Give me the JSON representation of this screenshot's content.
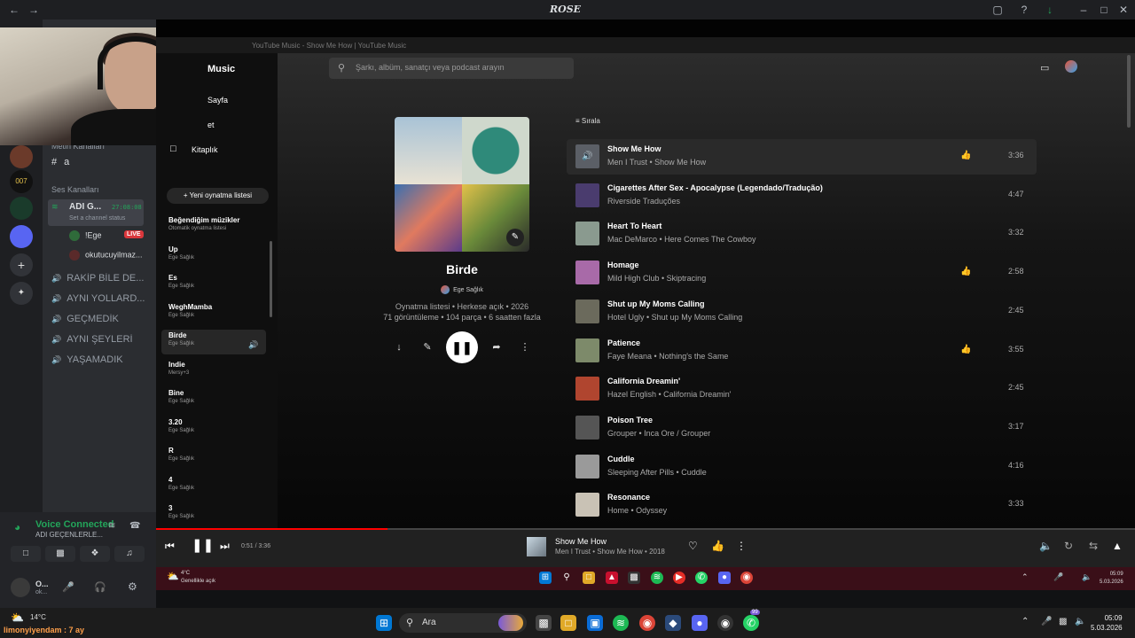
{
  "discord": {
    "title": "ROSE",
    "text_channels_header": "Metin Kanalları",
    "text_channel": "a",
    "voice_channels_header": "Ses Kanalları",
    "active_voice": {
      "name": "ADI G...",
      "timer": "27:08:08",
      "status_placeholder": "Set a channel status"
    },
    "members": [
      {
        "name": "!Ege",
        "badge": "LIVE"
      },
      {
        "name": "okutucuyilmaz..."
      }
    ],
    "voice_channels": [
      "RAKİP BİLE DE...",
      "AYNI YOLLARD...",
      "GEÇMEDİK",
      "AYNI ŞEYLERİ",
      "YAŞAMADIK"
    ],
    "voice_panel": {
      "status": "Voice Connected",
      "channel": "ADI GEÇENLERLE..."
    },
    "user": {
      "name": "O...",
      "sub": "ok..."
    }
  },
  "ytm": {
    "window_title": "YouTube Music - Show Me How | YouTube Music",
    "brand": "Music",
    "nav": [
      {
        "label": "Sayfa",
        "icon": "home-icon"
      },
      {
        "label": "et",
        "icon": "explore-icon"
      },
      {
        "label": "Kitaplık",
        "icon": "library-icon"
      }
    ],
    "new_playlist": "Yeni oynatma listesi",
    "sidebar_playlists": [
      {
        "title": "Beğendiğim müzikler",
        "sub": "Otomatik oynatma listesi"
      },
      {
        "title": "Up",
        "sub": "Ege Sağlık"
      },
      {
        "title": "Es",
        "sub": "Ege Sağlık"
      },
      {
        "title": "WeghMamba",
        "sub": "Ege Sağlık"
      },
      {
        "title": "Birde",
        "sub": "Ege Sağlık"
      },
      {
        "title": "Indie",
        "sub": "Mersy+3"
      },
      {
        "title": "Bine",
        "sub": "Ege Sağlık"
      },
      {
        "title": "3.20",
        "sub": "Ege Sağlık"
      },
      {
        "title": "R",
        "sub": "Ege Sağlık"
      },
      {
        "title": "4",
        "sub": "Ege Sağlık"
      },
      {
        "title": "3",
        "sub": "Ege Sağlık"
      }
    ],
    "search_placeholder": "Şarkı, albüm, sanatçı veya podcast arayın",
    "playlist": {
      "title": "Birde",
      "owner": "Ege Sağlık",
      "meta1": "Oynatma listesi • Herkese açık • 2026",
      "meta2": "71 görüntüleme • 104 parça • 6 saatten fazla"
    },
    "sort_label": "Sırala",
    "tracks": [
      {
        "title": "Show Me How",
        "sub": "Men I Trust • Show Me How",
        "duration": "3:36",
        "liked": true,
        "active": true,
        "color": "#5b5f66"
      },
      {
        "title": "Cigarettes After Sex - Apocalypse (Legendado/Tradução)",
        "sub": "Riverside Traduções",
        "duration": "4:47",
        "liked": false,
        "color": "#4a3c6e"
      },
      {
        "title": "Heart To Heart",
        "sub": "Mac DeMarco • Here Comes The Cowboy",
        "duration": "3:32",
        "liked": false,
        "color": "#8a9a8f"
      },
      {
        "title": "Homage",
        "sub": "Mild High Club • Skiptracing",
        "duration": "2:58",
        "liked": true,
        "color": "#a86aa8"
      },
      {
        "title": "Shut up My Moms Calling",
        "sub": "Hotel Ugly • Shut up My Moms Calling",
        "duration": "2:45",
        "liked": false,
        "color": "#6b6a5c"
      },
      {
        "title": "Patience",
        "sub": "Faye Meana • Nothing's the Same",
        "duration": "3:55",
        "liked": true,
        "color": "#7d8a6a"
      },
      {
        "title": "California Dreamin'",
        "sub": "Hazel English • California Dreamin'",
        "duration": "2:45",
        "liked": false,
        "color": "#b0452f"
      },
      {
        "title": "Poison Tree",
        "sub": "Grouper • Inca Ore / Grouper",
        "duration": "3:17",
        "liked": false,
        "color": "#555555"
      },
      {
        "title": "Cuddle",
        "sub": "Sleeping After Pills • Cuddle",
        "duration": "4:16",
        "liked": false,
        "color": "#9a9a9a"
      },
      {
        "title": "Resonance",
        "sub": "Home • Odyssey",
        "duration": "3:33",
        "liked": false,
        "color": "#c9c2b5"
      }
    ],
    "player": {
      "time": "0:51 / 3:36",
      "progress": 0.236,
      "now_title": "Show Me How",
      "now_sub": "Men I Trust • Show Me How • 2018"
    }
  },
  "inner_taskbar": {
    "temp": "4°C",
    "weather": "Genellikle açık",
    "time": "05:09",
    "date": "5.03.2026"
  },
  "taskbar": {
    "temp": "14°C",
    "overlay_text": "limonyiyendam : 7 ay",
    "search": "Ara",
    "time": "05:09",
    "date": "5.03.2026",
    "badge": "99"
  }
}
